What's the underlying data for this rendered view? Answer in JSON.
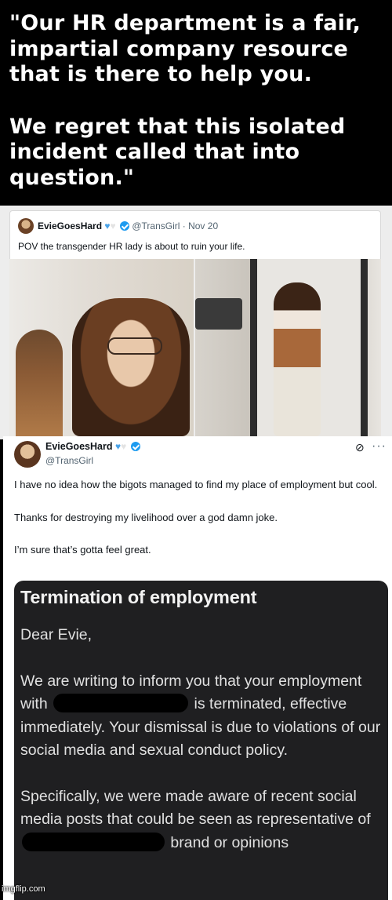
{
  "caption": {
    "line1": "\"Our HR department is a fair,\nimpartial company resource\nthat is there to help you.",
    "line2": "We regret that this isolated\nincident called that into\nquestion.\""
  },
  "tweet1": {
    "name": "EvieGoesHard",
    "handle": "@TransGirl",
    "dot": "·",
    "date": "Nov 20",
    "text": "POV the transgender HR lady is about to ruin your life."
  },
  "tweet2": {
    "name": "EvieGoesHard",
    "handle": "@TransGirl",
    "paragraphs": [
      "I have no idea how the bigots managed to find my place of employment but cool.",
      "Thanks for destroying my livelihood over a god damn joke.",
      "I’m sure that’s gotta feel great."
    ]
  },
  "notice": {
    "title": "Termination of employment",
    "greeting": "Dear Evie,",
    "p1_a": "We are writing to inform you that your employment with",
    "p1_b": "is terminated, effective immediately. Your dismissal is due to violations of our social media and sexual conduct policy.",
    "p2_a": "Specifically, we were made aware of recent social media posts that could be seen as representative of",
    "p2_b": "brand or opinions"
  },
  "watermark": "imgflip.com",
  "icons": {
    "verified": "verified-badge-icon",
    "heart_blue": "blue-heart-icon",
    "heart_white": "white-heart-icon",
    "grok": "grok-icon",
    "more": "more-icon"
  },
  "colors": {
    "verified": "#1d9bf0",
    "notice_bg": "#1f1f21",
    "caption_bg": "#000000"
  }
}
